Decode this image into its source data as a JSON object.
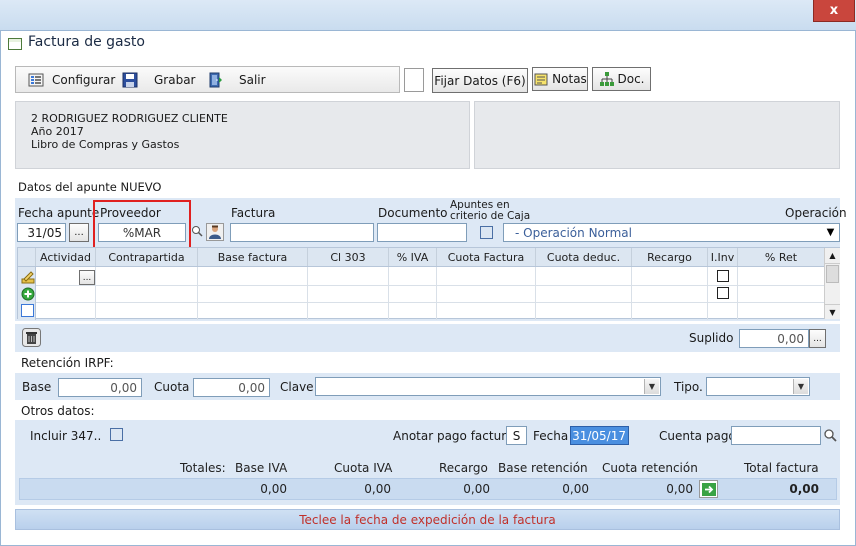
{
  "window": {
    "title": "Factura de gasto",
    "close_glyph": "x"
  },
  "toolbar": {
    "configurar": "Configurar",
    "grabar": "Grabar",
    "salir": "Salir",
    "fijar_datos": "Fijar Datos (F6)",
    "notas": "Notas",
    "doc": "Doc."
  },
  "info": {
    "line1": "2 RODRIGUEZ RODRIGUEZ CLIENTE",
    "line2": "Año 2017",
    "line3": "Libro de Compras y Gastos"
  },
  "apunte": {
    "section_title": "Datos del apunte NUEVO",
    "fecha_label": "Fecha apunte",
    "fecha_value": "31/05",
    "ellipsis": "...",
    "proveedor_label": "Proveedor",
    "proveedor_value": "%MAR",
    "factura_label": "Factura",
    "factura_value": "",
    "documento_label": "Documento",
    "documento_value": "",
    "apuntes_label_1": "Apuntes en",
    "apuntes_label_2": "criterio de Caja",
    "operacion_label": "Operación",
    "operacion_value": "- Operación Normal"
  },
  "grid": {
    "columns": [
      "Actividad",
      "Contrapartida",
      "Base factura",
      "Cl 303",
      "% IVA",
      "Cuota Factura",
      "Cuota deduc.",
      "Recargo",
      "I.Inv",
      "% Ret"
    ],
    "cell_button": "..."
  },
  "suplido": {
    "label": "Suplido",
    "value": "0,00",
    "ellipsis": "..."
  },
  "irpf": {
    "section_title": "Retención IRPF:",
    "base_label": "Base",
    "base_value": "0,00",
    "cuota_label": "Cuota",
    "cuota_value": "0,00",
    "clave_label": "Clave",
    "clave_value": "",
    "tipo_label": "Tipo.",
    "tipo_value": ""
  },
  "otros": {
    "section_title": "Otros datos:",
    "incluir_label": "Incluir 347..",
    "anotar_label": "Anotar pago factura",
    "anotar_value": "S",
    "fecha_label": "Fecha",
    "fecha_value": "31/05/17",
    "cuenta_label": "Cuenta pago",
    "cuenta_value": ""
  },
  "totales": {
    "label": "Totales:",
    "base_iva_label": "Base IVA",
    "cuota_iva_label": "Cuota IVA",
    "recargo_label": "Recargo",
    "base_ret_label": "Base retención",
    "cuota_ret_label": "Cuota retención",
    "total_label": "Total factura",
    "base_iva": "0,00",
    "cuota_iva": "0,00",
    "recargo": "0,00",
    "base_ret": "0,00",
    "cuota_ret": "0,00",
    "total": "0,00"
  },
  "status": {
    "message": "Teclee la fecha de expedición de la factura"
  },
  "colors": {
    "highlight_box": "#e02020",
    "status_text": "#c0302a",
    "accent_blue": "#3b78d8"
  }
}
